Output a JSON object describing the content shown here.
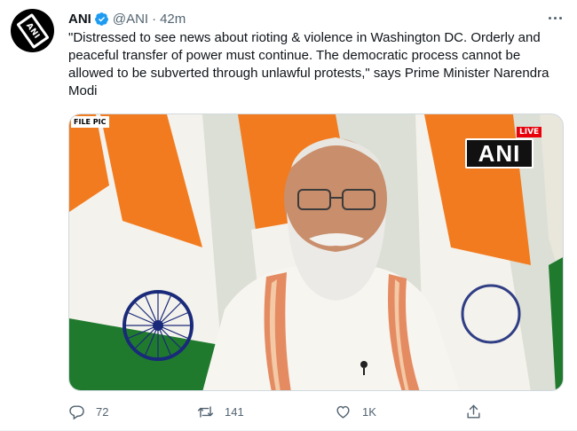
{
  "tweet": {
    "author_name": "ANI",
    "handle": "@ANI",
    "separator": "·",
    "time": "42m",
    "verified": true,
    "text": "\"Distressed to see news about rioting & violence in Washington DC. Orderly and peaceful transfer of power must continue. The democratic process cannot be allowed to be subverted through unlawful protests,\" says Prime Minister Narendra Modi",
    "avatar_text": "ANI"
  },
  "media": {
    "tag": "FILE PIC",
    "channel_logo": "ANI",
    "live_label": "LIVE"
  },
  "actions": {
    "reply_count": "72",
    "retweet_count": "141",
    "like_count": "1K"
  },
  "icons": {
    "reply": "reply-icon",
    "retweet": "retweet-icon",
    "like": "heart-icon",
    "share": "share-icon",
    "verified": "verified-badge-icon",
    "more": "more-icon"
  },
  "colors": {
    "verified": "#1d9bf0",
    "secondary_text": "#536471",
    "saffron": "#f27b1f",
    "flag_green": "#1f7a2e",
    "chakra": "#1a2a7a",
    "live": "#e8000b"
  }
}
